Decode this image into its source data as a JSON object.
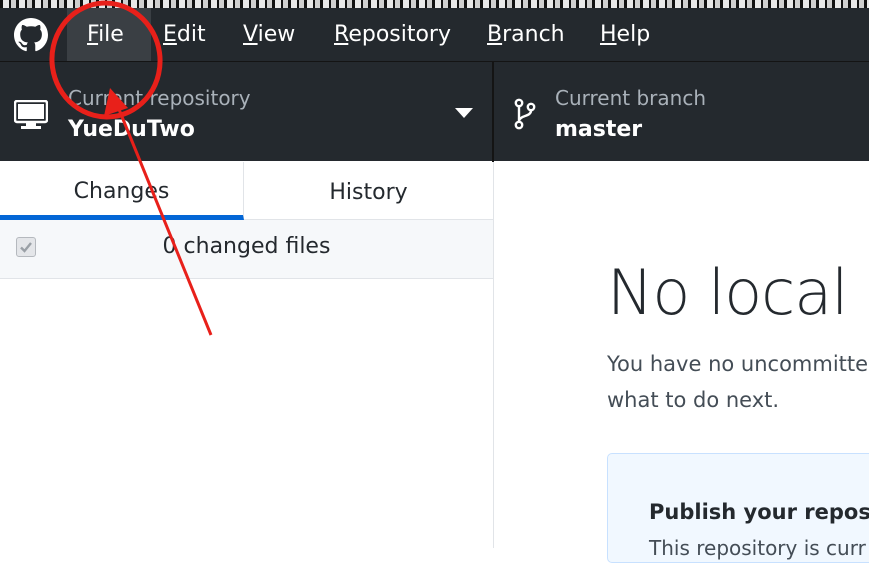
{
  "app": {
    "logo_icon": "github-octocat-icon"
  },
  "menu": {
    "items": [
      {
        "label": "File",
        "mnemonic": "F",
        "rest": "ile"
      },
      {
        "label": "Edit",
        "mnemonic": "E",
        "rest": "dit"
      },
      {
        "label": "View",
        "mnemonic": "V",
        "rest": "iew"
      },
      {
        "label": "Repository",
        "mnemonic": "R",
        "rest": "epository"
      },
      {
        "label": "Branch",
        "mnemonic": "B",
        "rest": "ranch"
      },
      {
        "label": "Help",
        "mnemonic": "H",
        "rest": "elp"
      }
    ]
  },
  "toolbar": {
    "repository": {
      "label": "Current repository",
      "value": "YueDuTwo",
      "icon": "desktop-computer-icon"
    },
    "branch": {
      "label": "Current branch",
      "value": "master",
      "icon": "git-branch-icon"
    }
  },
  "sidebar": {
    "tabs": [
      {
        "label": "Changes",
        "selected": true
      },
      {
        "label": "History",
        "selected": false
      }
    ],
    "changed_files_text": "0 changed files"
  },
  "main": {
    "title": "No local c",
    "description_line1": "You have no uncommitte",
    "description_line2": "what to do next.",
    "publish": {
      "title": "Publish your reposito",
      "subtitle": "This repository is curr"
    }
  },
  "colors": {
    "titlebar": "#24292e",
    "accent_blue": "#0366d6",
    "annotation_red": "#e8201a",
    "publish_bg": "#f1f8ff"
  }
}
